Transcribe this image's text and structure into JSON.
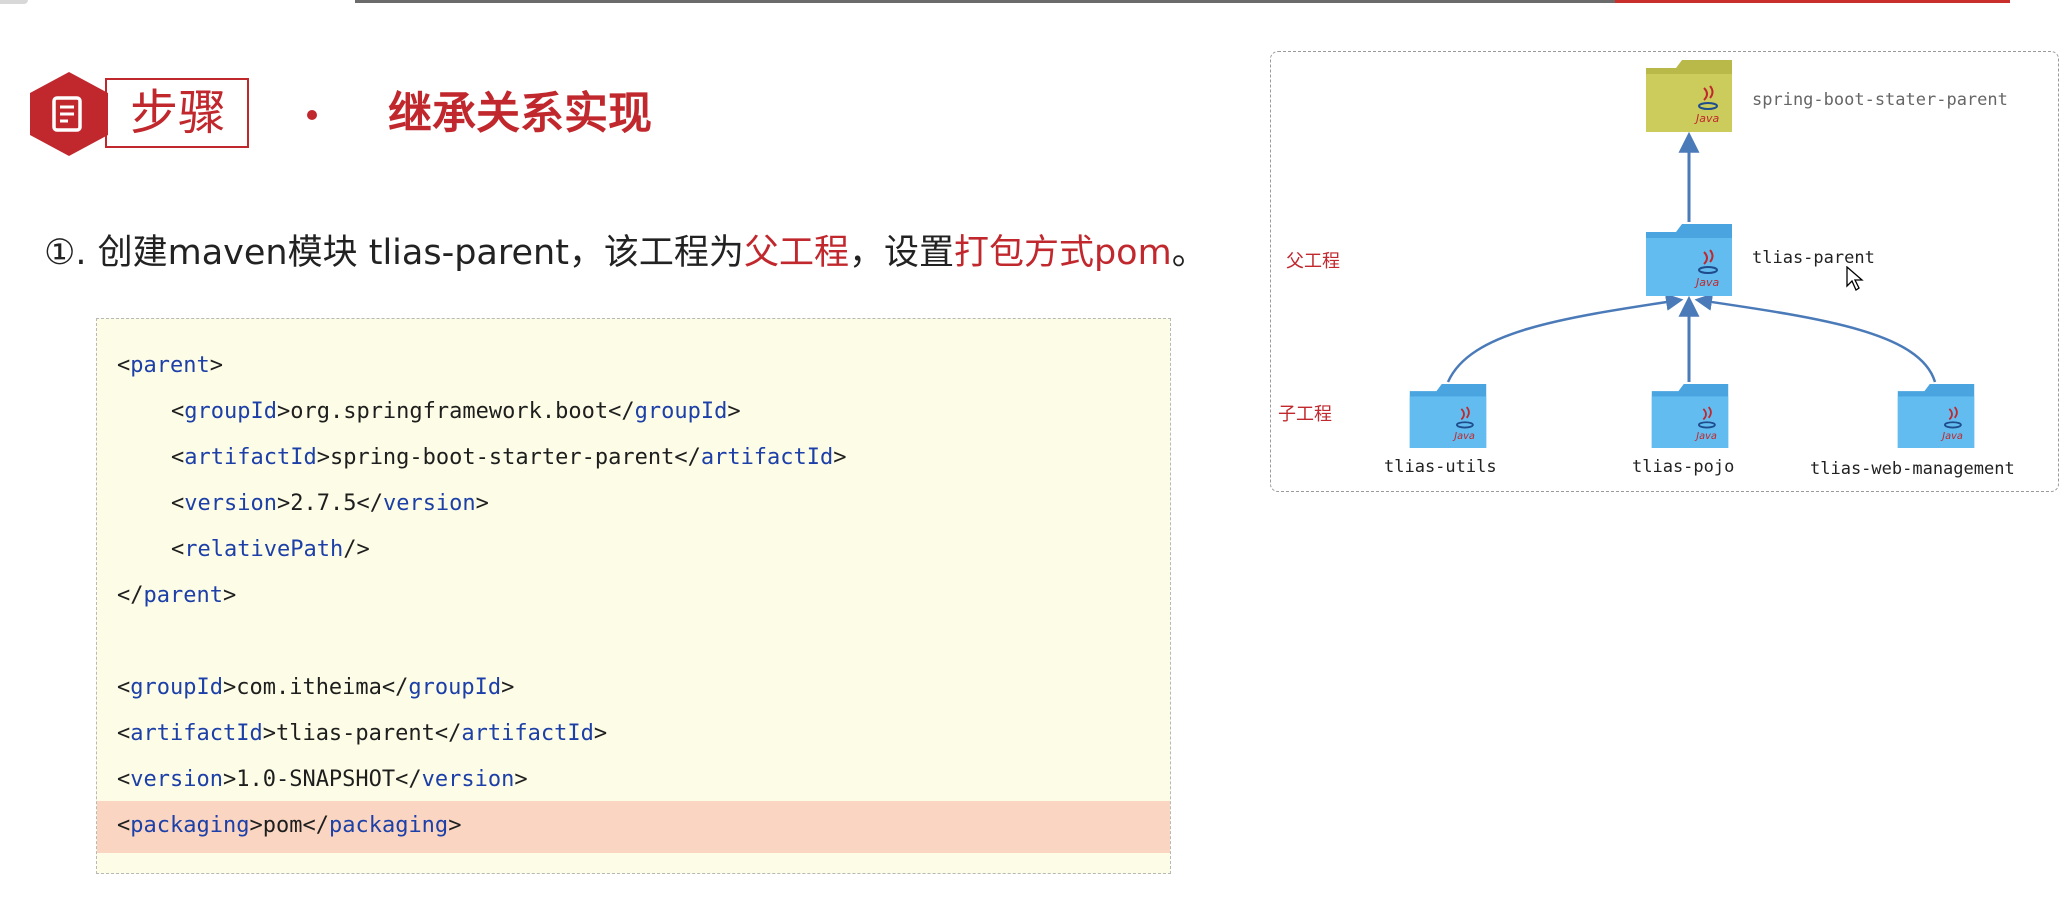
{
  "header": {
    "step_label": "步骤",
    "title": "继承关系实现"
  },
  "instruction": {
    "prefix": "①. 创建maven模块 tlias-parent，该工程为",
    "highlight1": "父工程",
    "middle": "，设置",
    "highlight2": "打包方式pom",
    "suffix": "。"
  },
  "code": {
    "l1_open": "<",
    "l1_tag": "parent",
    "l1_close": ">",
    "l2_tag": "groupId",
    "l2_val": "org.springframework.boot",
    "l3_tag": "artifactId",
    "l3_val": "spring-boot-starter-parent",
    "l4_tag": "version",
    "l4_val": "2.7.5",
    "l5_tag": "relativePath",
    "l6_tag": "parent",
    "l7_tag": "groupId",
    "l7_val": "com.itheima",
    "l8_tag": "artifactId",
    "l8_val": "tlias-parent",
    "l9_tag": "version",
    "l9_val": "1.0-SNAPSHOT",
    "l10_tag": "packaging",
    "l10_val": "pom"
  },
  "diagram": {
    "root": "spring-boot-stater-parent",
    "parent": "tlias-parent",
    "parent_side_label": "父工程",
    "child_side_label": "子工程",
    "children": [
      "tlias-utils",
      "tlias-pojo",
      "tlias-web-management"
    ],
    "folder_badge": "Java",
    "colors": {
      "root_folder": "#c8c85a",
      "project_folder": "#5ab4ec",
      "arrow": "#4a7ab8"
    }
  }
}
